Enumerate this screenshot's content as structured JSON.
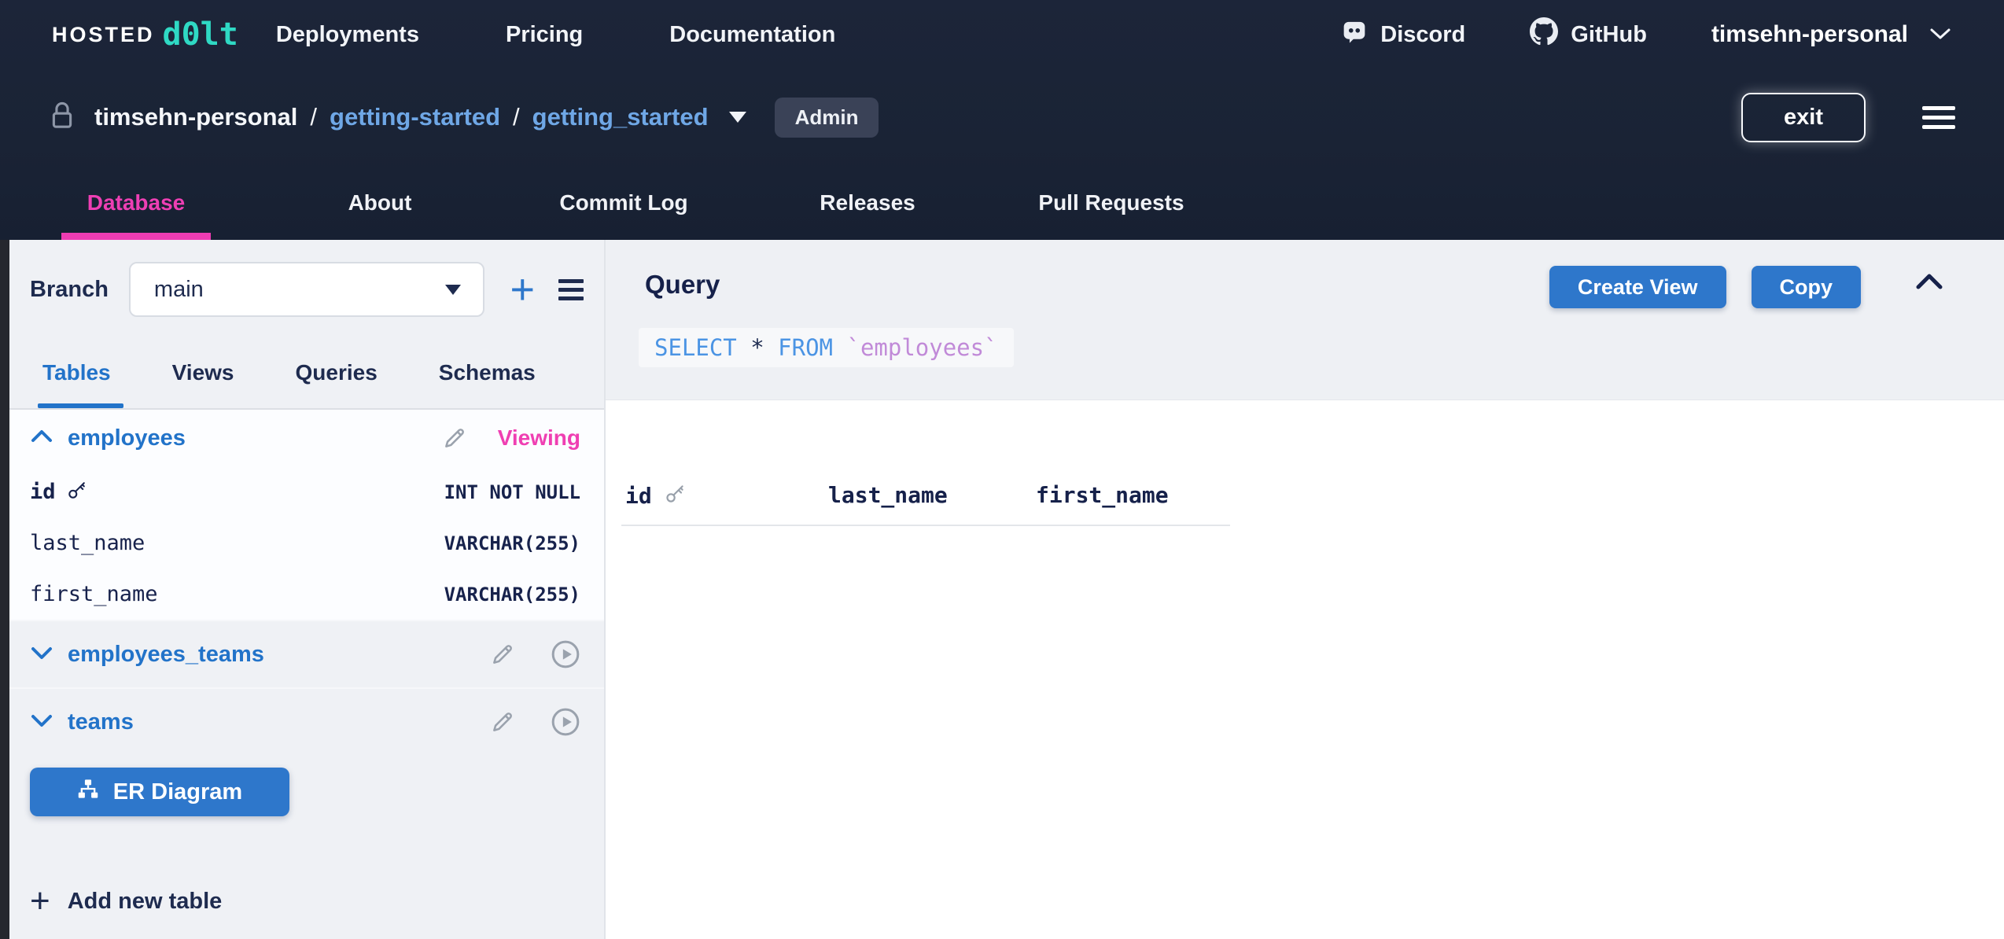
{
  "topnav": {
    "logo_hosted": "HOSTED",
    "logo_dolt": "d0lt",
    "links": [
      {
        "label": "Deployments"
      },
      {
        "label": "Pricing"
      },
      {
        "label": "Documentation"
      }
    ],
    "discord_label": "Discord",
    "github_label": "GitHub",
    "account": "timsehn-personal"
  },
  "breadcrumb": {
    "owner": "timsehn-personal",
    "separator": "/",
    "deployment": "getting-started",
    "database": "getting_started",
    "admin_badge": "Admin",
    "exit_label": "exit"
  },
  "repo_tabs": [
    {
      "label": "Database",
      "active": true
    },
    {
      "label": "About",
      "active": false
    },
    {
      "label": "Commit Log",
      "active": false
    },
    {
      "label": "Releases",
      "active": false
    },
    {
      "label": "Pull Requests",
      "active": false
    }
  ],
  "sidebar": {
    "branch_label": "Branch",
    "branch_value": "main",
    "tabs": [
      {
        "label": "Tables",
        "active": true
      },
      {
        "label": "Views",
        "active": false
      },
      {
        "label": "Queries",
        "active": false
      },
      {
        "label": "Schemas",
        "active": false
      }
    ],
    "tables": [
      {
        "name": "employees",
        "expanded": true,
        "status": "Viewing",
        "columns": [
          {
            "name": "id",
            "type": "INT NOT NULL",
            "primary_key": true
          },
          {
            "name": "last_name",
            "type": "VARCHAR(255)",
            "primary_key": false
          },
          {
            "name": "first_name",
            "type": "VARCHAR(255)",
            "primary_key": false
          }
        ]
      },
      {
        "name": "employees_teams",
        "expanded": false
      },
      {
        "name": "teams",
        "expanded": false
      }
    ],
    "er_button_label": "ER Diagram",
    "add_table_label": "Add new table"
  },
  "main": {
    "query_title": "Query",
    "sql": {
      "select": "SELECT",
      "star": "*",
      "from": "FROM",
      "table_ref": "`employees`"
    },
    "create_view_label": "Create View",
    "copy_label": "Copy",
    "result_columns": [
      "id",
      "last_name",
      "first_name"
    ]
  },
  "icons": [
    "discord-icon",
    "github-icon",
    "chevron-down-icon",
    "lock-icon",
    "hamburger-icon",
    "plus-icon",
    "pencil-icon",
    "play-circle-icon",
    "chevron-up-icon",
    "key-icon",
    "er-diagram-icon",
    "collapse-icon",
    "dropdown-caret-icon"
  ],
  "colors": {
    "header_navy": "#1b2336",
    "brand_teal": "#2fd9c4",
    "accent_pink": "#ee3cb2",
    "link_blue": "#6fa7e6",
    "primary_blue": "#2e77cb",
    "sidebar_blue": "#2273c9",
    "text_navy": "#1e2b4f",
    "sidebar_bg": "#eff1f5",
    "panel_bg": "#eef0f4",
    "sql_keyword": "#4b94e4",
    "sql_table": "#c18ad8"
  }
}
